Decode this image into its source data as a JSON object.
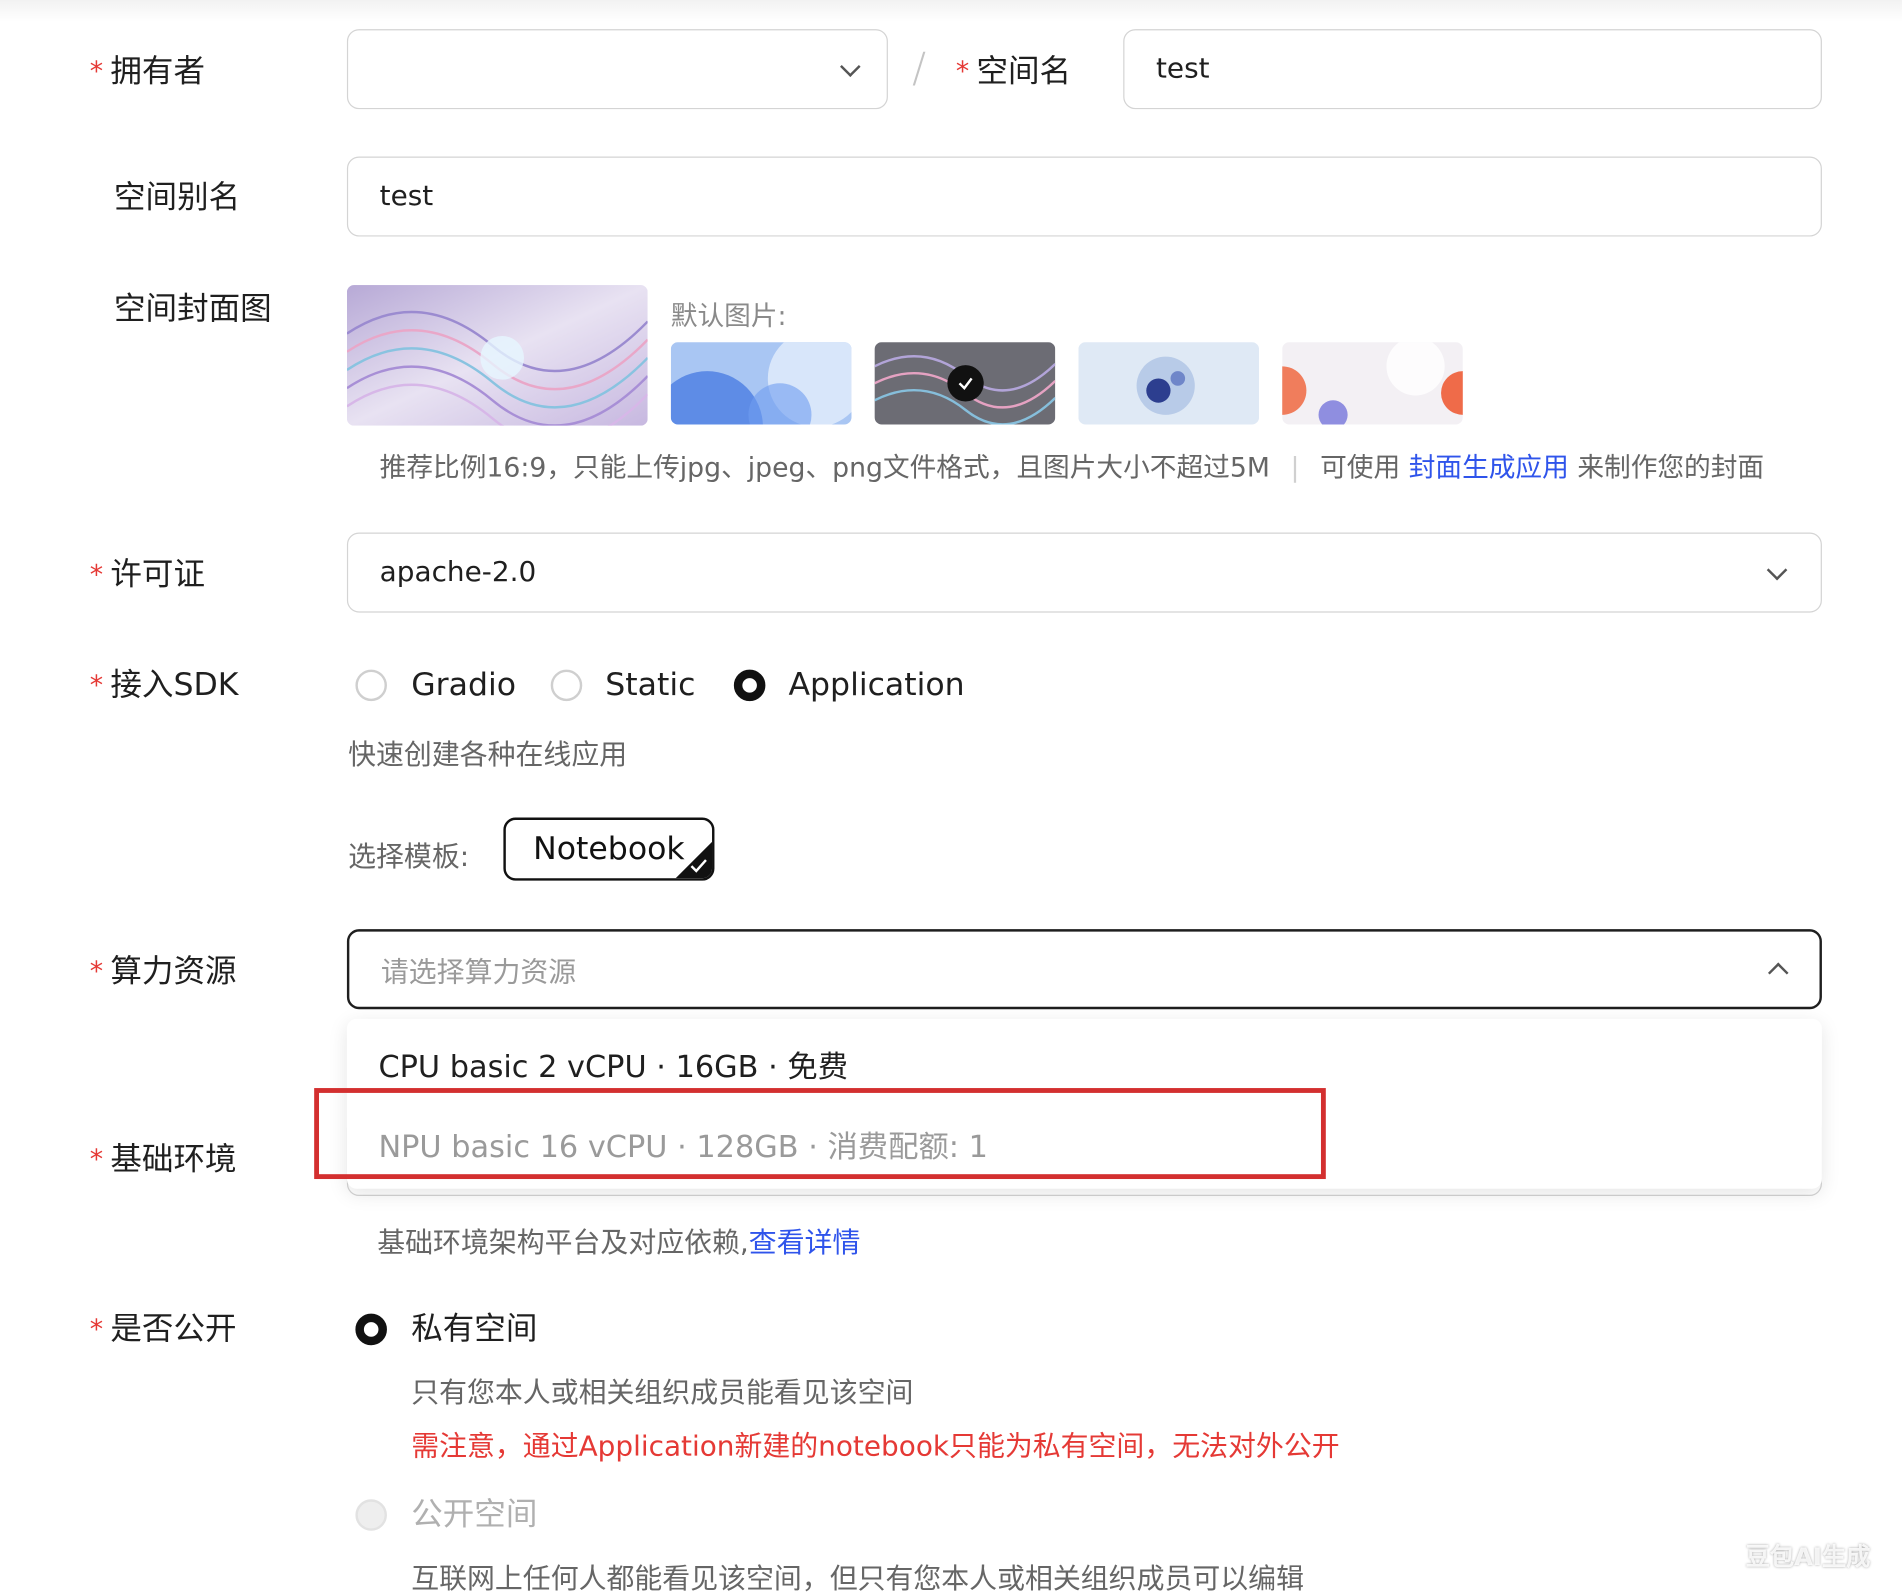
{
  "form": {
    "owner": {
      "required_mark": "*",
      "label": "拥有者",
      "value": ""
    },
    "separator": "/",
    "space_name": {
      "required_mark": "*",
      "label": "空间名",
      "value": "test"
    },
    "alias": {
      "label": "空间别名",
      "value": "test"
    },
    "cover": {
      "label": "空间封面图",
      "default_label": "默认图片:",
      "selected_index": 1,
      "thumbnail_count": 4,
      "hint": "推荐比例16:9，只能上传jpg、jpeg、png文件格式，且图片大小不超过5M",
      "hint_divider": "|",
      "hint_link_prefix": "可使用",
      "hint_link": "封面生成应用",
      "hint_link_suffix": "来制作您的封面"
    },
    "license": {
      "required_mark": "*",
      "label": "许可证",
      "value": "apache-2.0"
    },
    "sdk": {
      "required_mark": "*",
      "label": "接入SDK",
      "options": [
        "Gradio",
        "Static",
        "Application"
      ],
      "selected": "Application",
      "description": "快速创建各种在线应用",
      "template_label": "选择模板:",
      "template_value": "Notebook"
    },
    "compute": {
      "required_mark": "*",
      "label": "算力资源",
      "placeholder": "请选择算力资源",
      "options": [
        {
          "label": "CPU basic 2 vCPU · 16GB · 免费",
          "enabled": true
        },
        {
          "label": "NPU basic 16 vCPU · 128GB · 消费配额: 1",
          "enabled": false
        }
      ],
      "annotation_color": "#d32f2f"
    },
    "base_env": {
      "required_mark": "*",
      "label": "基础环境",
      "hint": "基础环境架构平台及对应依赖,",
      "hint_link": "查看详情"
    },
    "visibility": {
      "required_mark": "*",
      "label": "是否公开",
      "private": {
        "label": "私有空间",
        "desc": "只有您本人或相关组织成员能看见该空间",
        "warning": "需注意，通过Application新建的notebook只能为私有空间，无法对外公开"
      },
      "public": {
        "label": "公开空间",
        "desc": "互联网上任何人都能看见该空间，但只有您本人或相关组织成员可以编辑"
      }
    }
  },
  "colors": {
    "required": "#e53935",
    "link": "#2f54eb",
    "warning": "#e53935",
    "border": "#d4d4d4",
    "muted": "#666666"
  },
  "icons": [
    "chevron-down-icon",
    "chevron-up-icon",
    "check-icon"
  ],
  "watermark": "豆包AI生成"
}
